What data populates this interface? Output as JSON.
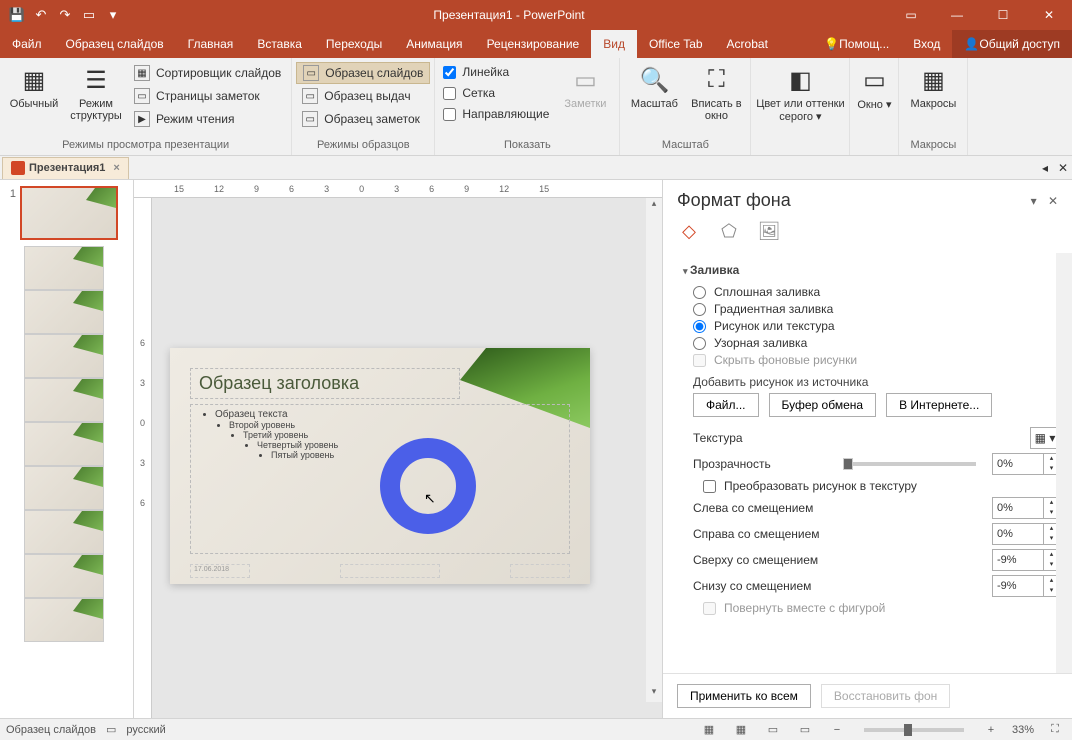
{
  "titlebar": {
    "title": "Презентация1 - PowerPoint"
  },
  "menubar": {
    "tabs": [
      "Файл",
      "Образец слайдов",
      "Главная",
      "Вставка",
      "Переходы",
      "Анимация",
      "Рецензирование",
      "Вид",
      "Office Tab",
      "Acrobat"
    ],
    "help": "Помощ...",
    "signin": "Вход",
    "share": "Общий доступ"
  },
  "ribbon": {
    "group1": {
      "label": "Режимы просмотра презентации",
      "b1": "Обычный",
      "b2": "Режим структуры",
      "s1": "Сортировщик слайдов",
      "s2": "Страницы заметок",
      "s3": "Режим чтения"
    },
    "group2": {
      "label": "Режимы образцов",
      "s1": "Образец слайдов",
      "s2": "Образец выдач",
      "s3": "Образец заметок"
    },
    "group3": {
      "label": "Показать",
      "c1": "Линейка",
      "c2": "Сетка",
      "c3": "Направляющие",
      "notes": "Заметки"
    },
    "group4": {
      "label": "Масштаб",
      "b1": "Масштаб",
      "b2": "Вписать в окно"
    },
    "group5": {
      "b1": "Цвет или оттенки серого"
    },
    "group6": {
      "b1": "Окно"
    },
    "group7": {
      "label": "Макросы",
      "b1": "Макросы"
    }
  },
  "doctab": {
    "name": "Презентация1"
  },
  "ruler": {
    "h": [
      "15",
      "12",
      "9",
      "6",
      "3",
      "0",
      "3",
      "6",
      "9",
      "12",
      "15"
    ],
    "v": [
      "6",
      "3",
      "0",
      "3",
      "6"
    ]
  },
  "slide": {
    "title_ph": "Образец заголовка",
    "body_l1": "Образец текста",
    "body_l2": "Второй уровень",
    "body_l3": "Третий уровень",
    "body_l4": "Четвертый уровень",
    "body_l5": "Пятый уровень",
    "date": "17.06.2018"
  },
  "thumbs": {
    "num1": "1"
  },
  "formatpane": {
    "title": "Формат фона",
    "section_fill": "Заливка",
    "r1": "Сплошная заливка",
    "r2": "Градиентная заливка",
    "r3": "Рисунок или текстура",
    "r4": "Узорная заливка",
    "hide": "Скрыть фоновые рисунки",
    "src_label": "Добавить рисунок из источника",
    "btn_file": "Файл...",
    "btn_clip": "Буфер обмена",
    "btn_web": "В Интернете...",
    "texture": "Текстура",
    "transparency": "Прозрачность",
    "transparency_val": "0%",
    "tile": "Преобразовать рисунок в текстуру",
    "off_left": "Слева со смещением",
    "off_left_val": "0%",
    "off_right": "Справа со смещением",
    "off_right_val": "0%",
    "off_top": "Сверху со смещением",
    "off_top_val": "-9%",
    "off_bottom": "Снизу со смещением",
    "off_bottom_val": "-9%",
    "rotate": "Повернуть вместе с фигурой",
    "apply_all": "Применить ко всем",
    "reset": "Восстановить фон"
  },
  "statusbar": {
    "mode": "Образец слайдов",
    "lang": "русский",
    "zoom": "33%"
  }
}
